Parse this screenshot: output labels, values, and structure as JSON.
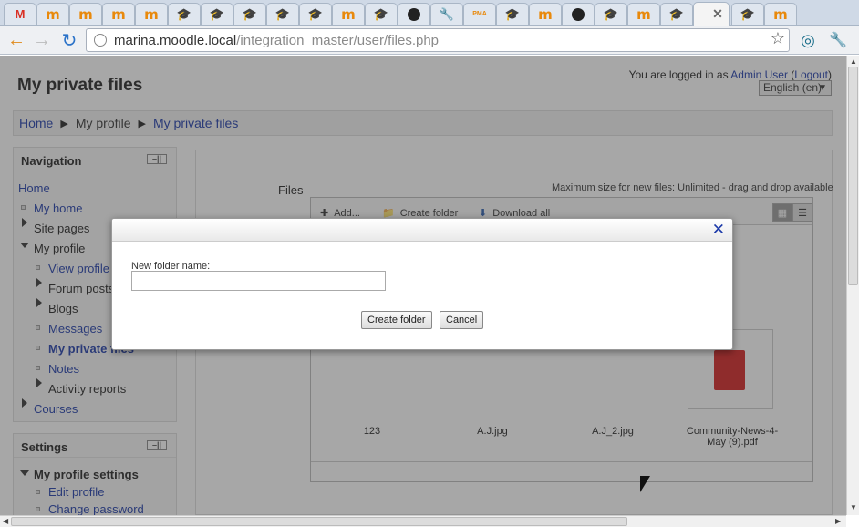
{
  "browser": {
    "url_host": "marina.moodle.local",
    "url_path": "/integration_master/user/files.php"
  },
  "tabs": [
    {
      "icon": "gmail-icon",
      "glyph": "M"
    },
    {
      "icon": "moodle-icon",
      "glyph": "m"
    },
    {
      "icon": "moodle-icon",
      "glyph": "m"
    },
    {
      "icon": "moodle-icon",
      "glyph": "m"
    },
    {
      "icon": "moodle-icon",
      "glyph": "m"
    },
    {
      "icon": "moodle-cap-icon",
      "glyph": "🎓"
    },
    {
      "icon": "moodle-cap-icon",
      "glyph": "🎓"
    },
    {
      "icon": "moodle-cap-icon",
      "glyph": "🎓"
    },
    {
      "icon": "moodle-cap-icon",
      "glyph": "🎓"
    },
    {
      "icon": "moodle-cap-icon",
      "glyph": "🎓"
    },
    {
      "icon": "moodle-icon",
      "glyph": "m"
    },
    {
      "icon": "moodle-cap-icon",
      "glyph": "🎓"
    },
    {
      "icon": "github-icon",
      "glyph": ""
    },
    {
      "icon": "wrench-icon",
      "glyph": "🔧"
    },
    {
      "icon": "phpmyadmin-icon",
      "glyph": "PMA"
    },
    {
      "icon": "moodle-cap-icon",
      "glyph": "🎓"
    },
    {
      "icon": "moodle-icon",
      "glyph": "m"
    },
    {
      "icon": "github-icon",
      "glyph": ""
    },
    {
      "icon": "moodle-cap-icon",
      "glyph": "🎓"
    },
    {
      "icon": "moodle-icon",
      "glyph": "m"
    },
    {
      "icon": "moodle-cap-icon",
      "glyph": "🎓"
    },
    {
      "icon": "close-icon",
      "glyph": "✕",
      "active": true
    },
    {
      "icon": "moodle-cap-icon",
      "glyph": "🎓"
    },
    {
      "icon": "moodle-icon",
      "glyph": "m"
    }
  ],
  "header": {
    "title": "My private files",
    "login_prefix": "You are logged in as ",
    "login_user": "Admin User",
    "login_open": " (",
    "logout": "Logout",
    "login_close": ")",
    "language": "English (en)"
  },
  "breadcrumb": {
    "items": [
      "Home",
      "My profile",
      "My private files"
    ]
  },
  "navigation": {
    "title": "Navigation",
    "home": "Home",
    "my_home": "My home",
    "site_pages": "Site pages",
    "my_profile": "My profile",
    "view_profile": "View profile",
    "forum_posts": "Forum posts",
    "blogs": "Blogs",
    "messages": "Messages",
    "my_private_files": "My private files",
    "notes": "Notes",
    "activity_reports": "Activity reports",
    "courses": "Courses"
  },
  "settings": {
    "title": "Settings",
    "my_profile_settings": "My profile settings",
    "edit_profile": "Edit profile",
    "change_password": "Change password"
  },
  "files": {
    "label": "Files",
    "max_size": "Maximum size for new files: Unlimited - drag and drop available",
    "add": "Add...",
    "create_folder": "Create folder",
    "download_all": "Download all",
    "items": [
      "123",
      "A.J.jpg",
      "A.J_2.jpg",
      "Community-News-4-May (9).pdf"
    ]
  },
  "dialog": {
    "field_label": "New folder name:",
    "field_value": "",
    "create_button": "Create folder",
    "cancel_button": "Cancel",
    "close_glyph": "✕"
  }
}
